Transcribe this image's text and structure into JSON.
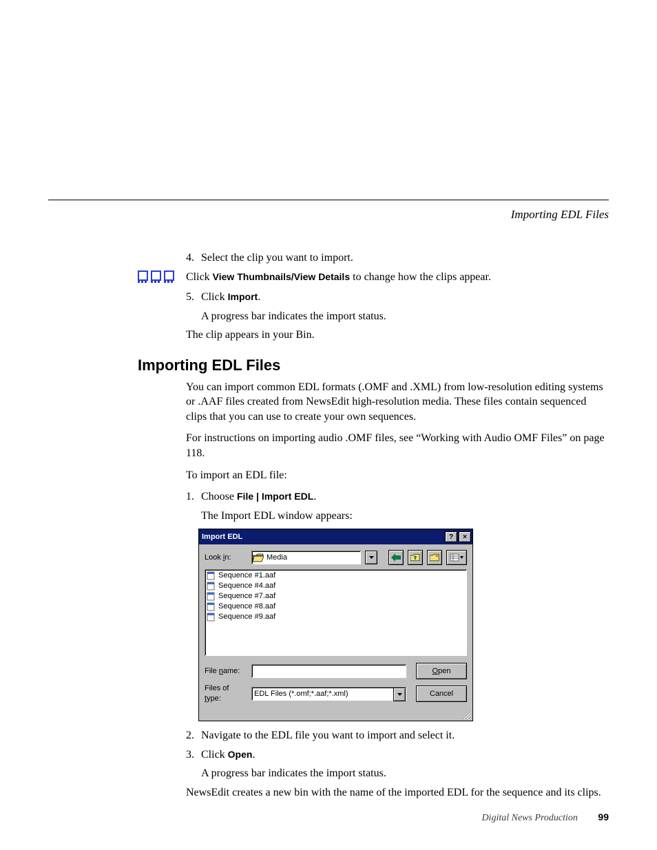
{
  "running_head": "Importing EDL Files",
  "steps_top": {
    "s4_num": "4.",
    "s4_text": "Select the clip you want to import.",
    "tip_prefix": "Click ",
    "tip_bold": "View Thumbnails/View Details",
    "tip_suffix": " to change how the clips appear.",
    "s5_num": "5.",
    "s5_pre": "Click ",
    "s5_bold": "Import",
    "s5_post": ".",
    "s5_sub": "A progress bar indicates the import status.",
    "end": "The clip appears in your Bin."
  },
  "heading": "Importing EDL Files",
  "intro": {
    "p1": "You can import common EDL formats (.OMF and .XML) from low-resolution editing systems or .AAF files created from NewsEdit high-resolution media. These files contain sequenced clips that you can use to create your own sequences.",
    "p2": "For instructions on importing audio .OMF files, see “Working with Audio OMF Files” on page 118.",
    "p3": "To import an EDL file:"
  },
  "steps_main": {
    "s1_num": "1.",
    "s1_pre": "Choose ",
    "s1_bold": "File | Import EDL",
    "s1_post": ".",
    "s1_sub": "The Import EDL window appears:",
    "s2_num": "2.",
    "s2_text": "Navigate to the EDL file you want to import and select it.",
    "s3_num": "3.",
    "s3_pre": "Click ",
    "s3_bold": "Open",
    "s3_post": ".",
    "s3_sub": "A progress bar indicates the import status.",
    "end": "NewsEdit creates a new bin with the name of the imported EDL for the sequence and its clips."
  },
  "dialog": {
    "title": "Import EDL",
    "help_glyph": "?",
    "close_glyph": "×",
    "look_in_label_pre": "Look ",
    "look_in_label_u": "i",
    "look_in_label_post": "n:",
    "look_in_value": "Media",
    "back_glyph": "⇦",
    "files": [
      "Sequence #1.aaf",
      "Sequence #4.aaf",
      "Sequence #7.aaf",
      "Sequence #8.aaf",
      "Sequence #9.aaf"
    ],
    "filename_label_pre": "File ",
    "filename_label_u": "n",
    "filename_label_post": "ame:",
    "filename_value": "",
    "filetype_label_pre": "Files of ",
    "filetype_label_u": "t",
    "filetype_label_post": "ype:",
    "filetype_value": "EDL Files (*.omf;*.aaf;*.xml)",
    "open_u": "O",
    "open_rest": "pen",
    "cancel": "Cancel"
  },
  "footer": {
    "label": "Digital News Production",
    "page": "99"
  }
}
